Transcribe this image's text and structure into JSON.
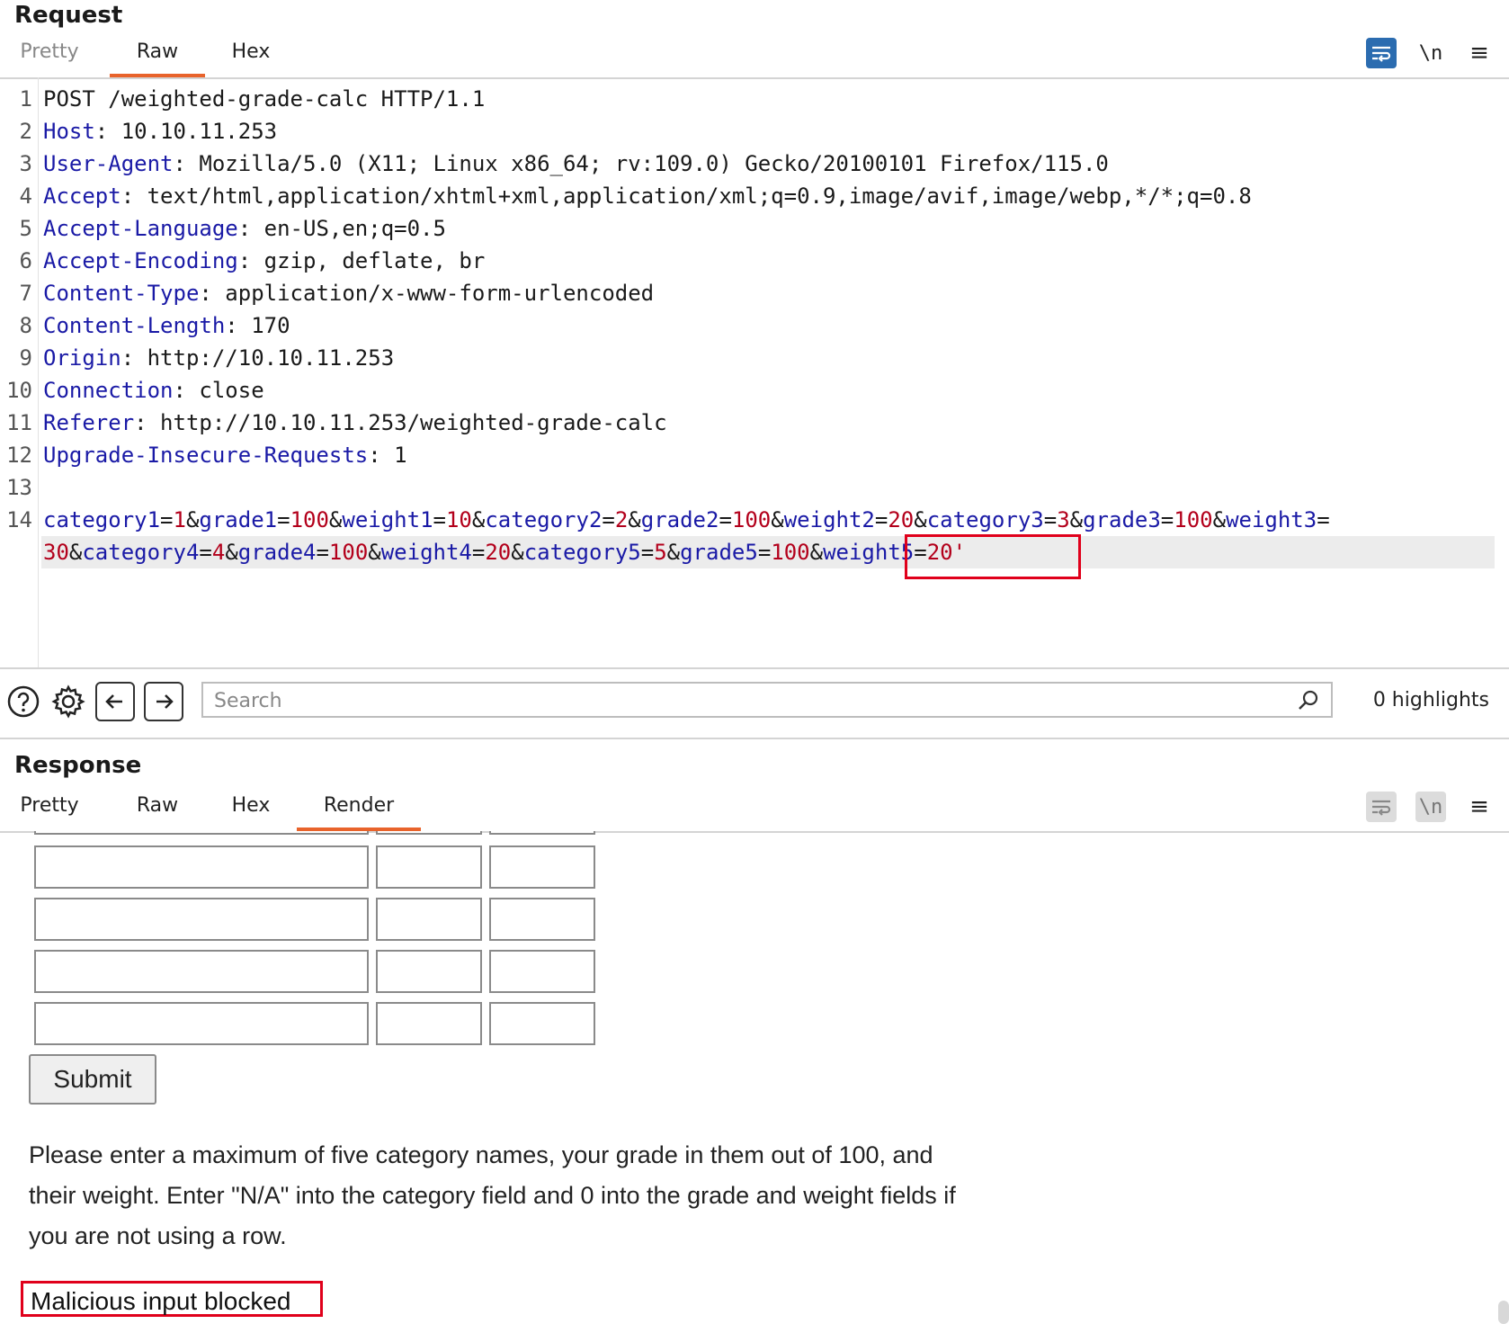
{
  "request": {
    "title": "Request",
    "tabs": [
      "Pretty",
      "Raw",
      "Hex"
    ],
    "active_tab": "Raw",
    "toolbar": {
      "newline_label": "\\n",
      "menu_label": "≡"
    },
    "line_numbers": [
      "1",
      "2",
      "3",
      "4",
      "5",
      "6",
      "7",
      "8",
      "9",
      "10",
      "11",
      "12",
      "13",
      "14"
    ],
    "request_line": "POST /weighted-grade-calc HTTP/1.1",
    "headers": [
      {
        "key": "Host",
        "value": " 10.10.11.253"
      },
      {
        "key": "User-Agent",
        "value": " Mozilla/5.0 (X11; Linux x86_64; rv:109.0) Gecko/20100101 Firefox/115.0"
      },
      {
        "key": "Accept",
        "value": " text/html,application/xhtml+xml,application/xml;q=0.9,image/avif,image/webp,*/*;q=0.8"
      },
      {
        "key": "Accept-Language",
        "value": " en-US,en;q=0.5"
      },
      {
        "key": "Accept-Encoding",
        "value": " gzip, deflate, br"
      },
      {
        "key": "Content-Type",
        "value": " application/x-www-form-urlencoded"
      },
      {
        "key": "Content-Length",
        "value": " 170"
      },
      {
        "key": "Origin",
        "value": " http://10.10.11.253"
      },
      {
        "key": "Connection",
        "value": " close"
      },
      {
        "key": "Referer",
        "value": " http://10.10.11.253/weighted-grade-calc"
      },
      {
        "key": "Upgrade-Insecure-Requests",
        "value": " 1"
      }
    ],
    "body_line1": [
      {
        "k": "category1",
        "v": "1"
      },
      {
        "k": "grade1",
        "v": "100"
      },
      {
        "k": "weight1",
        "v": "10"
      },
      {
        "k": "category2",
        "v": "2"
      },
      {
        "k": "grade2",
        "v": "100"
      },
      {
        "k": "weight2",
        "v": "20"
      },
      {
        "k": "category3",
        "v": "3"
      },
      {
        "k": "grade3",
        "v": "100"
      },
      {
        "k": "weight3",
        "v": ""
      }
    ],
    "body_line2": [
      {
        "k": "",
        "v": "30"
      },
      {
        "k": "category4",
        "v": "4"
      },
      {
        "k": "grade4",
        "v": "100"
      },
      {
        "k": "weight4",
        "v": "20"
      },
      {
        "k": "category5",
        "v": "5"
      },
      {
        "k": "grade5",
        "v": "100"
      },
      {
        "k": "weight5",
        "v": "20'"
      }
    ]
  },
  "searchbar": {
    "placeholder": "Search",
    "highlights": "0 highlights"
  },
  "response": {
    "title": "Response",
    "tabs": [
      "Pretty",
      "Raw",
      "Hex",
      "Render"
    ],
    "active_tab": "Render",
    "toolbar": {
      "newline_label": "\\n",
      "menu_label": "≡"
    },
    "render": {
      "submit_label": "Submit",
      "instructions": "Please enter a maximum of five category names, your grade in them out of 100, and their weight. Enter \"N/A\" into the category field and 0 into the grade and weight fields if you are not using a row.",
      "message": "Malicious input blocked"
    }
  },
  "colors": {
    "accent_tab": "#e8632b",
    "header_key": "#1a1aa6",
    "param_value": "#b3001b",
    "alert_box": "#e0001b",
    "wrap_button": "#2b6cb0"
  }
}
